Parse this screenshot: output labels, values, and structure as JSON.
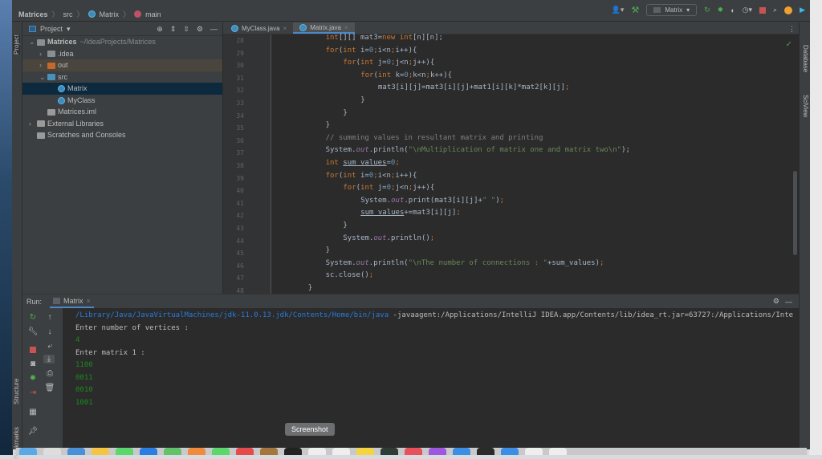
{
  "breadcrumb": [
    "Matrices",
    "src",
    "Matrix",
    "main"
  ],
  "toolbar": {
    "run_config": "Matrix"
  },
  "left_strip": {
    "project": "Project",
    "structure": "Structure",
    "bookmarks": "Bookmarks"
  },
  "right_strip": {
    "database": "Database",
    "sciview": "SciView"
  },
  "project": {
    "title": "Project",
    "tree": [
      {
        "label": "Matrices",
        "hint": "~/IdeaProjects/Matrices",
        "level": 0,
        "type": "module",
        "open": true
      },
      {
        "label": ".idea",
        "level": 1,
        "type": "folder"
      },
      {
        "label": "out",
        "level": 1,
        "type": "folder-out"
      },
      {
        "label": "src",
        "level": 1,
        "type": "folder-src",
        "open": true
      },
      {
        "label": "Matrix",
        "level": 2,
        "type": "class",
        "selected": true
      },
      {
        "label": "MyClass",
        "level": 2,
        "type": "class"
      },
      {
        "label": "Matrices.iml",
        "level": 1,
        "type": "file"
      },
      {
        "label": "External Libraries",
        "level": 0,
        "type": "lib"
      },
      {
        "label": "Scratches and Consoles",
        "level": 0,
        "type": "scratch"
      }
    ]
  },
  "tabs": [
    {
      "label": "MyClass.java",
      "active": false
    },
    {
      "label": "Matrix.java",
      "active": true
    }
  ],
  "code": [
    {
      "n": "28",
      "i": 2,
      "t": [
        [
          "int",
          "k"
        ],
        [
          "[][] mat3=",
          "p"
        ],
        [
          "new ",
          "k"
        ],
        [
          "int",
          "k"
        ],
        [
          "[n][n];",
          "p"
        ]
      ]
    },
    {
      "n": "29",
      "i": 2,
      "t": [
        [
          "for",
          "k"
        ],
        [
          "(",
          "p"
        ],
        [
          "int ",
          "k"
        ],
        [
          "i=",
          "p"
        ],
        [
          "0",
          "n"
        ],
        [
          ";",
          "sc"
        ],
        [
          "i<n",
          "p"
        ],
        [
          ";",
          "sc"
        ],
        [
          "i++){",
          "p"
        ]
      ]
    },
    {
      "n": "30",
      "i": 3,
      "t": [
        [
          "for",
          "k"
        ],
        [
          "(",
          "p"
        ],
        [
          "int ",
          "k"
        ],
        [
          "j=",
          "p"
        ],
        [
          "0",
          "n"
        ],
        [
          ";",
          "sc"
        ],
        [
          "j<n",
          "p"
        ],
        [
          ";",
          "sc"
        ],
        [
          "j++){",
          "p"
        ]
      ]
    },
    {
      "n": "31",
      "i": 4,
      "t": [
        [
          "for",
          "k"
        ],
        [
          "(",
          "p"
        ],
        [
          "int ",
          "k"
        ],
        [
          "k=",
          "p"
        ],
        [
          "0",
          "n"
        ],
        [
          ";",
          "sc"
        ],
        [
          "k<n",
          "p"
        ],
        [
          ";",
          "sc"
        ],
        [
          "k++){",
          "p"
        ]
      ]
    },
    {
      "n": "32",
      "i": 5,
      "t": [
        [
          "mat3[i][j]=mat3[i][j]+mat1[i][k]*mat2[k][j]",
          "p"
        ],
        [
          ";",
          "sc"
        ]
      ]
    },
    {
      "n": "33",
      "i": 4,
      "t": [
        [
          "}",
          "p"
        ]
      ]
    },
    {
      "n": "34",
      "i": 3,
      "t": [
        [
          "}",
          "p"
        ]
      ]
    },
    {
      "n": "35",
      "i": 2,
      "t": [
        [
          "}",
          "p"
        ]
      ]
    },
    {
      "n": "36",
      "i": 2,
      "t": [
        [
          "// summing values in resultant matrix and printing",
          "c"
        ]
      ]
    },
    {
      "n": "37",
      "i": 2,
      "t": [
        [
          "System.",
          "p"
        ],
        [
          "out",
          "f"
        ],
        [
          ".println(",
          "p"
        ],
        [
          "\"\\nMultiplication of matrix one and matrix two\\n\"",
          "s"
        ],
        [
          ");",
          "p"
        ]
      ]
    },
    {
      "n": "38",
      "i": 2,
      "t": [
        [
          "int ",
          "k"
        ],
        [
          "sum_values",
          "u"
        ],
        [
          "=",
          "p"
        ],
        [
          "0",
          "n"
        ],
        [
          ";",
          "sc"
        ]
      ]
    },
    {
      "n": "39",
      "i": 2,
      "t": [
        [
          "for",
          "k"
        ],
        [
          "(",
          "p"
        ],
        [
          "int ",
          "k"
        ],
        [
          "i=",
          "p"
        ],
        [
          "0",
          "n"
        ],
        [
          ";",
          "sc"
        ],
        [
          "i<n",
          "p"
        ],
        [
          ";",
          "sc"
        ],
        [
          "i++){",
          "p"
        ]
      ]
    },
    {
      "n": "40",
      "i": 3,
      "t": [
        [
          "for",
          "k"
        ],
        [
          "(",
          "p"
        ],
        [
          "int ",
          "k"
        ],
        [
          "j=",
          "p"
        ],
        [
          "0",
          "n"
        ],
        [
          ";",
          "sc"
        ],
        [
          "j<n",
          "p"
        ],
        [
          ";",
          "sc"
        ],
        [
          "j++){",
          "p"
        ]
      ]
    },
    {
      "n": "41",
      "i": 4,
      "t": [
        [
          "System.",
          "p"
        ],
        [
          "out",
          "f"
        ],
        [
          ".print(mat3[i][j]+",
          "p"
        ],
        [
          "\" \"",
          "s"
        ],
        [
          ")",
          "p"
        ],
        [
          ";",
          "sc"
        ]
      ]
    },
    {
      "n": "42",
      "i": 4,
      "t": [
        [
          "sum_values",
          "u"
        ],
        [
          "+=mat3[i][j]",
          "p"
        ],
        [
          ";",
          "sc"
        ]
      ]
    },
    {
      "n": "43",
      "i": 3,
      "t": [
        [
          "}",
          "p"
        ]
      ]
    },
    {
      "n": "44",
      "i": 3,
      "t": [
        [
          "System.",
          "p"
        ],
        [
          "out",
          "f"
        ],
        [
          ".println()",
          "p"
        ],
        [
          ";",
          "sc"
        ]
      ]
    },
    {
      "n": "45",
      "i": 2,
      "t": [
        [
          "}",
          "p"
        ]
      ]
    },
    {
      "n": "46",
      "i": 2,
      "t": [
        [
          "System.",
          "p"
        ],
        [
          "out",
          "f"
        ],
        [
          ".println(",
          "p"
        ],
        [
          "\"\\nThe number of connections : \"",
          "s"
        ],
        [
          "+sum_values)",
          "p"
        ],
        [
          ";",
          "sc"
        ]
      ]
    },
    {
      "n": "47",
      "i": 2,
      "t": [
        [
          "sc.close()",
          "p"
        ],
        [
          ";",
          "sc"
        ]
      ]
    },
    {
      "n": "48",
      "i": 1,
      "t": [
        [
          "}",
          "p"
        ]
      ]
    }
  ],
  "run": {
    "label": "Run:",
    "tab": "Matrix",
    "output": [
      {
        "text": "/Library/Java/JavaVirtualMachines/jdk-11.0.13.jdk/Contents/Home/bin/java",
        "extra": " -javaagent:/Applications/IntelliJ IDEA.app/Contents/lib/idea_rt.jar=63727:/Applications/Inte",
        "type": "path"
      },
      {
        "text": "Enter number of vertices :",
        "type": "out"
      },
      {
        "text": "4",
        "type": "inp"
      },
      {
        "text": "Enter matrix 1 :",
        "type": "out"
      },
      {
        "text": "1100",
        "type": "inp"
      },
      {
        "text": "0011",
        "type": "inp"
      },
      {
        "text": "0010",
        "type": "inp"
      },
      {
        "text": "1001",
        "type": "inp"
      }
    ]
  },
  "tooltip": "Screenshot"
}
